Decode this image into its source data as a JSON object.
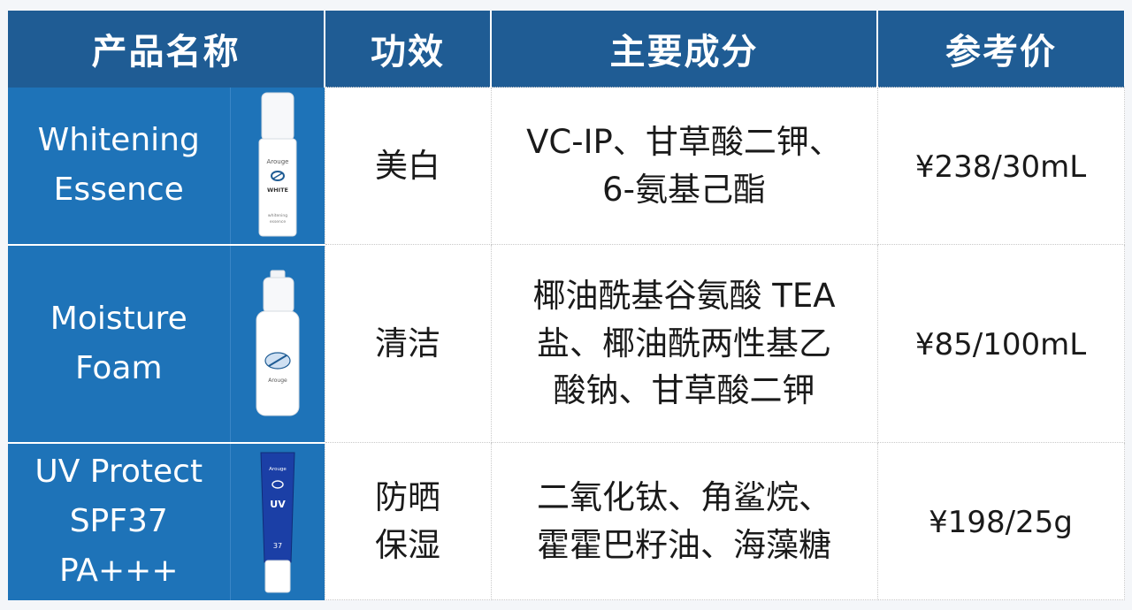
{
  "table": {
    "headers": [
      "产品名称",
      "功效",
      "主要成分",
      "参考价"
    ],
    "rows": [
      {
        "name": "Whitening\nEssence",
        "image_label": "essence-bottle",
        "effect": "美白",
        "ingredients": "VC-IP、甘草酸二钾、\n6-氨基己酯",
        "price": "¥238/30mL"
      },
      {
        "name": "Moisture\nFoam",
        "image_label": "foam-pump-bottle",
        "effect": "清洁",
        "ingredients": "椰油酰基谷氨酸 TEA\n盐、椰油酰两性基乙\n酸钠、甘草酸二钾",
        "price": "¥85/100mL"
      },
      {
        "name": "UV Protect\nSPF37\nPA+++",
        "image_label": "sunscreen-tube",
        "effect": "防晒\n保湿",
        "ingredients": "二氧化钛、角鲨烷、\n霍霍巴籽油、海藻糖",
        "price": "¥198/25g"
      }
    ]
  },
  "product_labels": {
    "brand": "Arouge",
    "essence_line1": "WHITE",
    "essence_line2": "whitening",
    "essence_line3": "essence",
    "uv_text": "UV",
    "uv_spf": "37"
  },
  "colors": {
    "header_bg": "#1f5c94",
    "name_col_bg": "#1e73b8",
    "text": "#1a1a1a"
  }
}
